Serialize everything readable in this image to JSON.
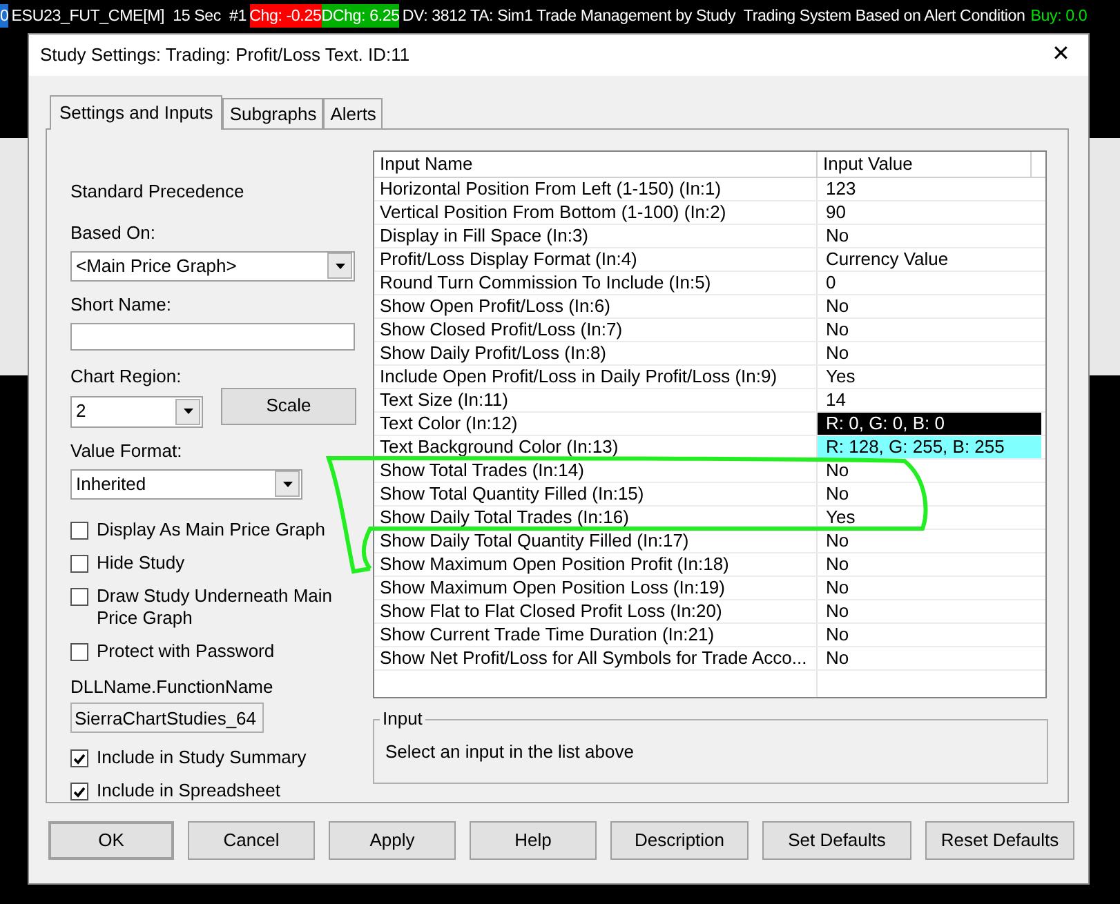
{
  "chart_header": [
    {
      "kind": "badge",
      "text": "0",
      "color": "#1e6fd0"
    },
    {
      "kind": "plain",
      "text": "ESU23_FUT_CME[M]  15 Sec  #1"
    },
    {
      "kind": "badge",
      "text": "Chg: -0.25",
      "color": "#ff0000"
    },
    {
      "kind": "badge",
      "text": "DChg: 6.25",
      "color": "#00b000"
    },
    {
      "kind": "plain",
      "text": "DV: 3812 TA: Sim1 Trade Management by Study  Trading System Based on Alert Condition"
    },
    {
      "kind": "colored",
      "text": "Buy: 0.0",
      "color": "#00e000"
    }
  ],
  "window": {
    "title": "Study Settings: Trading: Profit/Loss Text. ID:11",
    "close": "✕"
  },
  "tabs": [
    {
      "label": "Settings and Inputs",
      "selected": true
    },
    {
      "label": "Subgraphs",
      "selected": false
    },
    {
      "label": "Alerts",
      "selected": false
    }
  ],
  "settings": {
    "precedence": "Standard Precedence",
    "based_on": {
      "label": "Based On:",
      "value": "<Main Price Graph>"
    },
    "short_name": {
      "label": "Short Name:"
    },
    "chart_region": {
      "label": "Chart Region:",
      "value": "2"
    },
    "scale_button": "Scale",
    "value_format": {
      "label": "Value Format:",
      "value": "Inherited"
    },
    "checkboxes": [
      {
        "label": "Display As Main Price Graph",
        "checked": false
      },
      {
        "label": "Hide Study",
        "checked": false
      },
      {
        "label": "Draw Study Underneath Main Price Graph",
        "checked": false
      },
      {
        "label": "Protect with Password",
        "checked": false
      }
    ],
    "dll": {
      "label": "DLLName.FunctionName",
      "value": "SierraChartStudies_64"
    },
    "checkboxes_2": [
      {
        "label": "Include in Study Summary",
        "checked": true
      },
      {
        "label": "Include in Spreadsheet",
        "checked": true
      }
    ]
  },
  "table": {
    "columns": [
      "Input Name",
      "Input Value"
    ],
    "rows": [
      {
        "name": "Horizontal Position From Left (1-150)   (In:1)",
        "value": "123"
      },
      {
        "name": "Vertical Position From Bottom (1-100)   (In:2)",
        "value": "90"
      },
      {
        "name": "Display in Fill Space   (In:3)",
        "value": "No"
      },
      {
        "name": "Profit/Loss Display Format   (In:4)",
        "value": "Currency Value"
      },
      {
        "name": "Round Turn Commission To Include   (In:5)",
        "value": "0"
      },
      {
        "name": "Show Open Profit/Loss   (In:6)",
        "value": "No"
      },
      {
        "name": "Show Closed Profit/Loss   (In:7)",
        "value": "No"
      },
      {
        "name": "Show Daily Profit/Loss   (In:8)",
        "value": "No"
      },
      {
        "name": "Include Open Profit/Loss in Daily Profit/Loss   (In:9)",
        "value": "Yes"
      },
      {
        "name": "Text Size   (In:11)",
        "value": "14"
      },
      {
        "name": "Text Color   (In:12)",
        "value": "R: 0, G: 0, B: 0",
        "color": "#000000"
      },
      {
        "name": "Text Background Color   (In:13)",
        "value": "R: 128, G: 255, B: 255",
        "color": "#80ffff"
      },
      {
        "name": "Show Total Trades   (In:14)",
        "value": "No"
      },
      {
        "name": "Show Total Quantity Filled   (In:15)",
        "value": "No"
      },
      {
        "name": "Show Daily Total Trades   (In:16)",
        "value": "Yes"
      },
      {
        "name": "Show Daily Total Quantity Filled   (In:17)",
        "value": "No"
      },
      {
        "name": "Show Maximum Open Position Profit   (In:18)",
        "value": "No"
      },
      {
        "name": "Show Maximum Open Position Loss   (In:19)",
        "value": "No"
      },
      {
        "name": "Show Flat to Flat Closed Profit Loss   (In:20)",
        "value": "No"
      },
      {
        "name": "Show Current Trade Time Duration   (In:21)",
        "value": "No"
      },
      {
        "name": "Show Net Profit/Loss for All Symbols for Trade Acco...",
        "value": "No"
      }
    ]
  },
  "input_group": {
    "title": "Input",
    "text": "Select an input in the list above"
  },
  "buttons": [
    "OK",
    "Cancel",
    "Apply",
    "Help",
    "Description",
    "Set Defaults",
    "Reset Defaults"
  ]
}
